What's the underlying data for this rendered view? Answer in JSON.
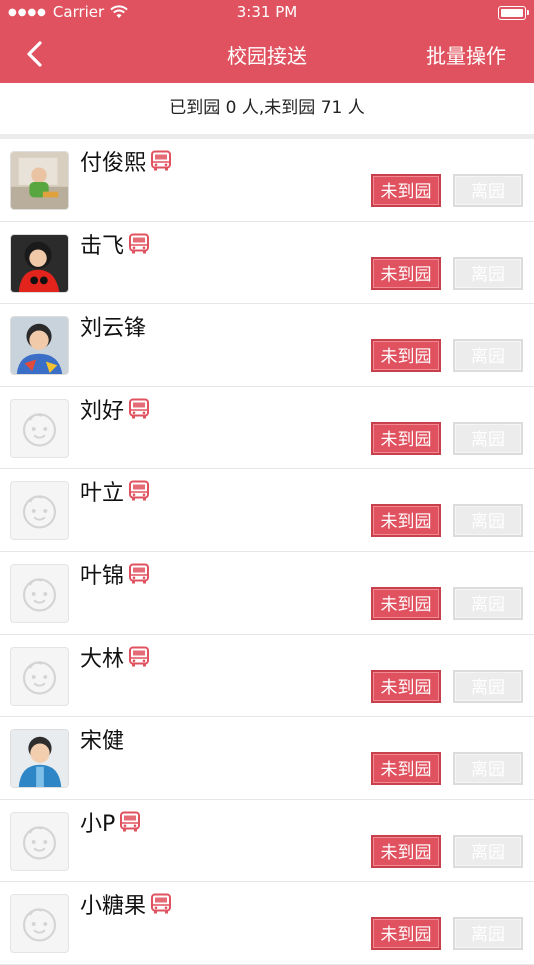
{
  "status_bar": {
    "carrier": "Carrier",
    "time": "3:31 PM"
  },
  "nav": {
    "title": "校园接送",
    "batch_label": "批量操作"
  },
  "summary": "已到园 0 人,未到园 71 人",
  "buttons": {
    "absent": "未到园",
    "leave": "离园"
  },
  "students": [
    {
      "name": "付俊熙",
      "bus": true,
      "avatar": "photo-1"
    },
    {
      "name": "击飞",
      "bus": true,
      "avatar": "photo-2"
    },
    {
      "name": "刘云锋",
      "bus": false,
      "avatar": "photo-3"
    },
    {
      "name": "刘好",
      "bus": true,
      "avatar": "placeholder"
    },
    {
      "name": "叶立",
      "bus": true,
      "avatar": "placeholder"
    },
    {
      "name": "叶锦",
      "bus": true,
      "avatar": "placeholder"
    },
    {
      "name": "大林",
      "bus": true,
      "avatar": "placeholder"
    },
    {
      "name": "宋健",
      "bus": false,
      "avatar": "photo-4"
    },
    {
      "name": "小P",
      "bus": true,
      "avatar": "placeholder"
    },
    {
      "name": "小糖果",
      "bus": true,
      "avatar": "placeholder"
    }
  ],
  "colors": {
    "accent": "#e0525f",
    "bus_icon": "#e0525f",
    "leave_button": "#ececec"
  }
}
